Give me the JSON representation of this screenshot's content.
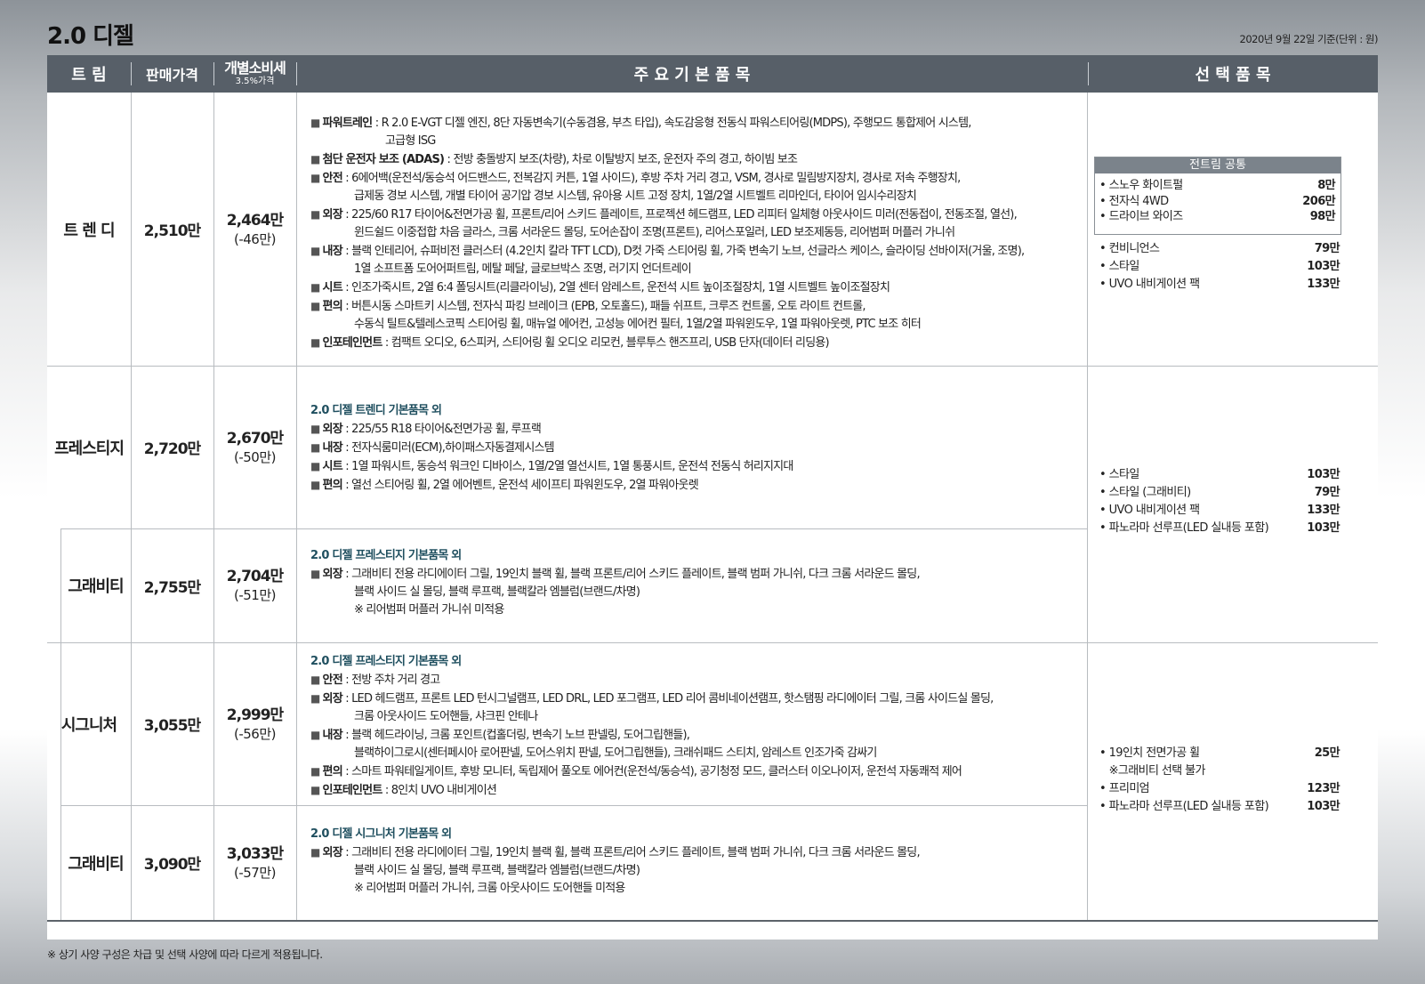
{
  "title": "2.0 디젤",
  "date_note": "2020년 9월 22일 기준(단위 : 원)",
  "footnote": "※ 상기 사양 구성은 차급 및 선택 사양에 따라 다르게 적용됩니다.",
  "header": {
    "trim": "트 림",
    "price": "판매가격",
    "tax_price_line1": "개별소비세",
    "tax_price_line2": "3.5%가격",
    "features": "주 요 기 본 품 목",
    "options": "선 택 품 목"
  },
  "rows": [
    {
      "trim": "트 렌 디",
      "price": "2,510만",
      "tax_price": "2,464만",
      "tax_diff": "(-46만)",
      "lines": [
        {
          "label": "파워트레인",
          "text": " : R 2.0 E-VGT 디젤 엔진, 8단 자동변속기(수동겸용, 부츠 타입), 속도감응형 전동식 파워스티어링(MDPS), 주행모드 통합제어 시스템,"
        },
        {
          "cont": "고급형 ISG"
        },
        {
          "label": "첨단 운전자 보조 (ADAS)",
          "text": " : 전방 충돌방지 보조(차량), 차로 이탈방지 보조, 운전자 주의 경고, 하이빔 보조"
        },
        {
          "label": "안전",
          "text": " : 6에어백(운전석/동승석 어드밴스드, 전복감지 커튼, 1열 사이드), 후방 주차 거리 경고, VSM, 경사로 밀림방지장치, 경사로 저속 주행장치,"
        },
        {
          "cont": "급제동 경보 시스템, 개별 타이어 공기압 경보 시스템, 유아용 시트 고정 장치, 1열/2열 시트벨트 리마인더, 타이어 임시수리장치"
        },
        {
          "label": "외장",
          "text": " : 225/60 R17 타이어&전면가공 휠, 프론트/리어 스키드 플레이트, 프로젝션 헤드램프, LED 리피터 일체형 아웃사이드 미러(전동접이, 전동조절, 열선),"
        },
        {
          "cont": "윈드쉴드 이중접합 차음 글라스, 크롬 서라운드 몰딩, 도어손잡이 조명(프론트), 리어스포일러, LED 보조제동등, 리어범퍼 머플러 가니쉬"
        },
        {
          "label": "내장",
          "text": " : 블랙 인테리어, 슈퍼비전 클러스터 (4.2인치 칼라 TFT LCD), D컷 가죽 스티어링 휠, 가죽 변속기 노브, 선글라스 케이스, 슬라이딩 선바이저(거울, 조명),"
        },
        {
          "cont": "1열 소프트폼 도어어퍼트림, 메탈 페달, 글로브박스 조명, 러기지 언더트레이"
        },
        {
          "label": "시트",
          "text": " : 인조가죽시트, 2열 6:4 폴딩시트(리클라이닝), 2열 센터 암레스트, 운전석 시트 높이조절장치, 1열 시트벨트 높이조절장치"
        },
        {
          "label": "편의",
          "text": " : 버튼시동 스마트키 시스템, 전자식 파킹 브레이크 (EPB, 오토홀드), 패들 쉬프트, 크루즈 컨트롤, 오토 라이트 컨트롤,"
        },
        {
          "cont": "수동식 틸트&텔레스코픽 스티어링 휠, 매뉴얼 에어컨, 고성능 에어컨 필터, 1열/2열 파워윈도우, 1열 파워아웃렛, PTC 보조 히터"
        },
        {
          "label": "인포테인먼트",
          "text": " : 컴팩트 오디오, 6스피커, 스티어링 휠 오디오 리모컨, 블루투스 핸즈프리, USB 단자(데이터 리딩용)"
        }
      ]
    },
    {
      "trim": "프레스티지",
      "price": "2,720만",
      "tax_price": "2,670만",
      "tax_diff": "(-50만)",
      "subtitle": "2.0 디젤 트렌디 기본품목 외",
      "lines": [
        {
          "label": "외장",
          "text": " : 225/55 R18 타이어&전면가공 휠, 루프랙"
        },
        {
          "label": "내장",
          "text": " : 전자식룸미러(ECM),하이패스자동결제시스템"
        },
        {
          "label": "시트",
          "text": " : 1열 파워시트, 동승석 워크인 디바이스, 1열/2열 열선시트, 1열 통풍시트, 운전석 전동식 허리지지대"
        },
        {
          "label": "편의",
          "text": " : 열선 스티어링 휠, 2열 에어벤트, 운전석 세이프티 파워윈도우, 2열 파워아웃렛"
        }
      ]
    },
    {
      "trim": "그래비티",
      "price": "2,755만",
      "tax_price": "2,704만",
      "tax_diff": "(-51만)",
      "subtitle": "2.0 디젤 프레스티지 기본품목 외",
      "lines": [
        {
          "label": "외장",
          "text": " : 그래비티 전용 라디에이터 그릴, 19인치 블랙 휠,  블랙 프론트/리어 스키드 플레이트, 블랙 범퍼 가니쉬, 다크 크롬 서라운드 몰딩,"
        },
        {
          "cont": "블랙 사이드 실 몰딩, 블랙 루프랙, 블랙칼라 엠블럼(브랜드/차명)"
        },
        {
          "cont": "※ 리어범퍼  머플러 가니쉬 미적용"
        }
      ]
    },
    {
      "trim": "시그니처",
      "price": "3,055만",
      "tax_price": "2,999만",
      "tax_diff": "(-56만)",
      "subtitle": "2.0 디젤 프레스티지 기본품목 외",
      "lines": [
        {
          "label": "안전",
          "text": " : 전방 주차 거리 경고"
        },
        {
          "label": "외장",
          "text": " : LED 헤드램프, 프론트 LED 턴시그널램프, LED DRL, LED 포그램프, LED 리어 콤비네이션램프, 핫스탬핑 라디에이터 그릴, 크롬 사이드실 몰딩,"
        },
        {
          "cont": "크롬 아웃사이드 도어핸들, 샤크핀 안테나"
        },
        {
          "label": "내장",
          "text": " : 블랙 헤드라이닝, 크롬 포인트(컵홀더링, 변속기 노브 판넬링, 도어그립핸들),"
        },
        {
          "cont": "블랙하이그로시(센터페시아 로어판넬, 도어스위치 판넬, 도어그립핸들), 크래쉬패드 스티치, 암레스트 인조가죽 감싸기"
        },
        {
          "label": "편의",
          "text": " : 스마트 파워테일게이트, 후방 모니터, 독립제어 풀오토 에어컨(운전석/동승석), 공기청정 모드, 클러스터 이오나이저, 운전석 자동쾌적 제어"
        },
        {
          "label": "인포테인먼트",
          "text": " : 8인치 UVO 내비게이션"
        }
      ]
    },
    {
      "trim": "그래비티",
      "price": "3,090만",
      "tax_price": "3,033만",
      "tax_diff": "(-57만)",
      "subtitle": "2.0 디젤 시그니처 기본품목 외",
      "lines": [
        {
          "label": "외장",
          "text": " : 그래비티 전용 라디에이터 그릴, 19인치 블랙 휠,  블랙 프론트/리어 스키드 플레이트, 블랙 범퍼 가니쉬, 다크 크롬 서라운드 몰딩,"
        },
        {
          "cont": "블랙 사이드 실 몰딩, 블랙 루프랙, 블랙칼라 엠블럼(브랜드/차명)"
        },
        {
          "cont": "※ 리어범퍼  머플러 가니쉬, 크롬 아웃사이드 도어핸들 미적용"
        }
      ]
    }
  ],
  "options": {
    "common_box": {
      "title": "전트림 공통",
      "items": [
        {
          "name": "• 스노우 화이트펄",
          "price": "8만"
        },
        {
          "name": "• 전자식 4WD",
          "price": "206만"
        },
        {
          "name": "• 드라이브 와이즈",
          "price": "98만"
        }
      ]
    },
    "trendy": [
      {
        "name": "• 컨비니언스",
        "price": "79만"
      },
      {
        "name": "• 스타일",
        "price": "103만"
      },
      {
        "name": "• UVO 내비게이션 팩",
        "price": "133만"
      }
    ],
    "prestige": [
      {
        "name": "• 스타일",
        "price": "103만"
      },
      {
        "name": "• 스타일 (그래비티)",
        "price": "79만"
      },
      {
        "name": "• UVO 내비게이션 팩",
        "price": "133만"
      },
      {
        "name": "• 파노라마 선루프(LED 실내등 포함)",
        "price": "103만"
      }
    ],
    "signature": [
      {
        "name": "• 19인치 전면가공 휠",
        "price": "25만"
      },
      {
        "name": "   ※그래비티 선택 불가",
        "price": ""
      },
      {
        "name": "• 프리미엄",
        "price": "123만"
      },
      {
        "name": "• 파노라마 선루프(LED 실내등 포함)",
        "price": "103만"
      }
    ]
  },
  "colors": {
    "header_bg": "#575f68",
    "subtitle": "#1f4f5f",
    "box_header": "#7b838b"
  }
}
